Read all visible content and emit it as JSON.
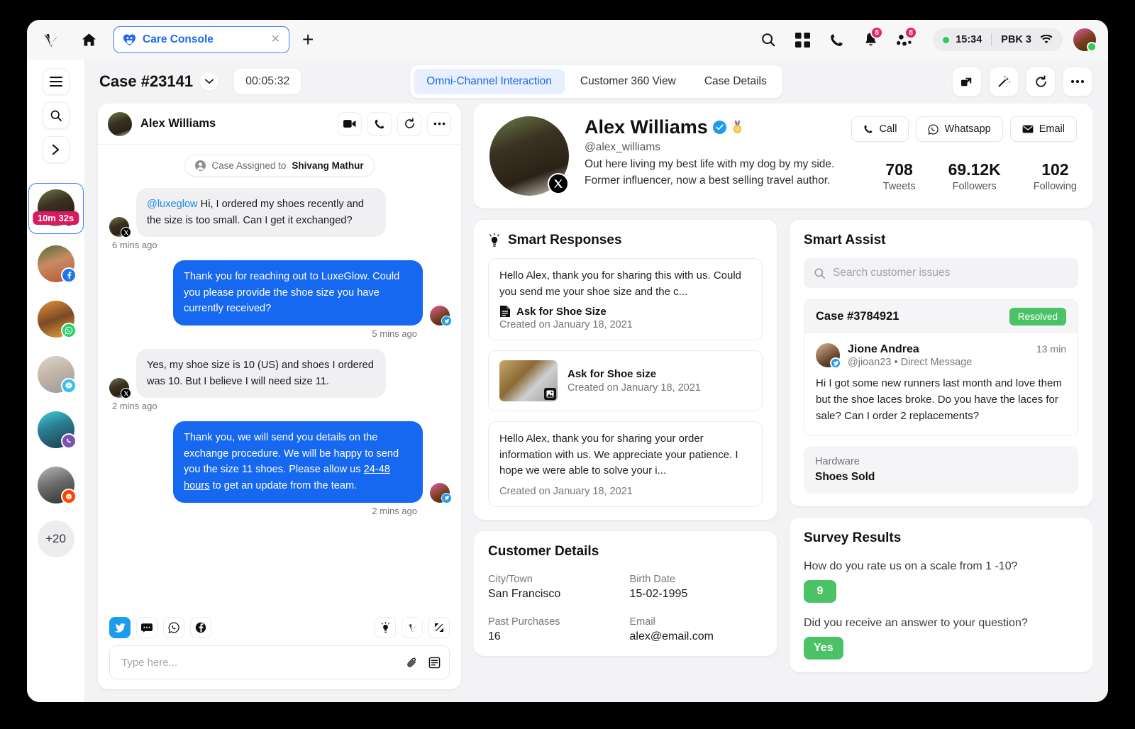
{
  "browser": {
    "logo_icon": "pega-logo-icon",
    "home_icon": "home-icon",
    "tab": {
      "favicon": "care-console-heart-icon",
      "title": "Care Console",
      "close_icon": "close-icon"
    },
    "new_tab_label": "+",
    "icons": {
      "search": "search-icon",
      "apps": "apps-grid-icon",
      "phone": "phone-icon",
      "bell": "bell-icon",
      "group": "group-icon",
      "wifi": "wifi-icon"
    },
    "notification_badge": "8",
    "group_badge": "8",
    "status": {
      "time": "15:34",
      "device": "PBK 3"
    }
  },
  "rail": {
    "buttons": [
      {
        "name": "menu-button",
        "icon": "hamburger-icon"
      },
      {
        "name": "search-button",
        "icon": "search-icon"
      },
      {
        "name": "expand-button",
        "icon": "chevron-right-icon"
      }
    ],
    "conversations": [
      {
        "name": "alex-williams",
        "channel": "x-twitter",
        "timer": "10m 32s",
        "active": true
      },
      {
        "name": "contact-2",
        "channel": "facebook",
        "active": false
      },
      {
        "name": "contact-3",
        "channel": "whatsapp",
        "active": false
      },
      {
        "name": "contact-4",
        "channel": "messenger",
        "active": false
      },
      {
        "name": "contact-5",
        "channel": "viber",
        "active": false
      },
      {
        "name": "contact-6",
        "channel": "reddit",
        "active": false
      }
    ],
    "more_label": "+20"
  },
  "toolbar": {
    "case_title": "Case #23141",
    "chevron_icon": "chevron-down-icon",
    "timer": "00:05:32",
    "tabs": [
      {
        "label": "Omni-Channel Interaction",
        "active": true
      },
      {
        "label": "Customer 360 View",
        "active": false
      },
      {
        "label": "Case Details",
        "active": false
      }
    ],
    "actions": [
      {
        "name": "popout-button",
        "icon": "popout-icon"
      },
      {
        "name": "magic-wand-button",
        "icon": "magic-wand-icon"
      },
      {
        "name": "refresh-button",
        "icon": "refresh-icon"
      },
      {
        "name": "more-options-button",
        "icon": "ellipsis-icon"
      }
    ]
  },
  "chat": {
    "header_name": "Alex Williams",
    "header_actions": [
      {
        "name": "video-call-button",
        "icon": "video-icon"
      },
      {
        "name": "voice-call-button",
        "icon": "phone-icon"
      },
      {
        "name": "refresh-button",
        "icon": "refresh-icon"
      },
      {
        "name": "more-button",
        "icon": "ellipsis-icon"
      }
    ],
    "system_note": {
      "prefix": "Case Assigned to ",
      "agent": "Shivang Mathur"
    },
    "messages": [
      {
        "direction": "in",
        "mention": "@luxeglow",
        "text": " Hi, I ordered my shoes recently and the size is too small. Can I get it exchanged?",
        "time": "6 mins ago"
      },
      {
        "direction": "out",
        "text": "Thank you for reaching out to LuxeGlow. Could you please provide the shoe size you have currently received?",
        "time": "5 mins ago"
      },
      {
        "direction": "in",
        "text": "Yes, my shoe size is 10 (US) and shoes I ordered was 10. But I believe I will need size 11.",
        "time": "2 mins ago"
      },
      {
        "direction": "out",
        "text_part1": "Thank you, we will send you details on the exchange procedure. We will be happy to send you the size 11 shoes. Please allow us ",
        "link": "24-48 hours",
        "text_part2": " to get an update from the team.",
        "time": "2 mins ago"
      }
    ],
    "channels": [
      {
        "name": "twitter-channel",
        "icon": "twitter-icon",
        "selected": true
      },
      {
        "name": "sms-channel",
        "icon": "sms-icon",
        "selected": false
      },
      {
        "name": "whatsapp-channel",
        "icon": "whatsapp-icon",
        "selected": false
      },
      {
        "name": "facebook-channel",
        "icon": "facebook-icon",
        "selected": false
      }
    ],
    "right_tools": [
      {
        "name": "suggestion-button",
        "icon": "lightbulb-icon"
      },
      {
        "name": "pega-assist-button",
        "icon": "pega-logo-icon"
      },
      {
        "name": "expand-button",
        "icon": "expand-icon"
      }
    ],
    "input_placeholder": "Type here...",
    "input_value": "",
    "input_icons": [
      {
        "name": "attach-button",
        "icon": "paperclip-icon"
      },
      {
        "name": "template-button",
        "icon": "document-icon"
      }
    ]
  },
  "profile": {
    "name": "Alex Williams",
    "verified_icon": "verified-badge-icon",
    "award_icon": "medal-icon",
    "handle": "@alex_williams",
    "bio": "Out here living my best life with my dog by my side. Former influencer, now a best selling travel author.",
    "platform_icon": "x-twitter-icon",
    "buttons": [
      {
        "label": "Call",
        "icon": "phone-icon",
        "name": "call-button"
      },
      {
        "label": "Whatsapp",
        "icon": "whatsapp-icon",
        "name": "whatsapp-button"
      },
      {
        "label": "Email",
        "icon": "envelope-icon",
        "name": "email-button"
      }
    ],
    "stats": [
      {
        "value": "708",
        "label": "Tweets"
      },
      {
        "value": "69.12K",
        "label": "Followers"
      },
      {
        "value": "102",
        "label": "Following"
      }
    ]
  },
  "smart_responses": {
    "title": "Smart Responses",
    "icon": "lightbulb-icon",
    "items": [
      {
        "text": "Hello Alex, thank you for sharing this with us. Could you send me your shoe size and the c...",
        "doc_icon": "document-icon",
        "name": "Ask for Shoe Size",
        "date": "Created on January 18, 2021",
        "has_thumb": false
      },
      {
        "text": "",
        "name": "Ask for Shoe size",
        "date": "Created on January 18, 2021",
        "has_thumb": true,
        "thumb_icon": "image-icon"
      },
      {
        "text": "Hello Alex, thank you for sharing your order information with us. We appreciate your patience. I hope we were able to solve your i...",
        "name": "",
        "date": "Created on January 18, 2021",
        "has_thumb": false
      }
    ]
  },
  "smart_assist": {
    "title": "Smart Assist",
    "search_placeholder": "Search customer issues",
    "search_value": "",
    "search_icon": "search-icon",
    "case": {
      "id": "Case #3784921",
      "status": "Resolved",
      "status_color": "#4cc266",
      "author": "Jione Andrea",
      "handle_line": "@jioan23 • Direct Message",
      "time": "13 min",
      "message": "Hi I got some new runners last month and love them but the shoe laces broke. Do you have the laces for sale? Can I order 2 replacements?",
      "hardware_label": "Hardware",
      "hardware_value": "Shoes Sold"
    }
  },
  "customer_details": {
    "title": "Customer Details",
    "fields": [
      {
        "label": "City/Town",
        "value": "San Francisco"
      },
      {
        "label": "Birth Date",
        "value": "15-02-1995"
      },
      {
        "label": "Past Purchases",
        "value": "16"
      },
      {
        "label": "Email",
        "value": "alex@email.com"
      }
    ]
  },
  "survey": {
    "title": "Survey Results",
    "items": [
      {
        "question": "How do you rate us on a scale from 1 -10?",
        "answer": "9"
      },
      {
        "question": "Did you receive an answer to your question?",
        "answer": "Yes"
      }
    ]
  }
}
